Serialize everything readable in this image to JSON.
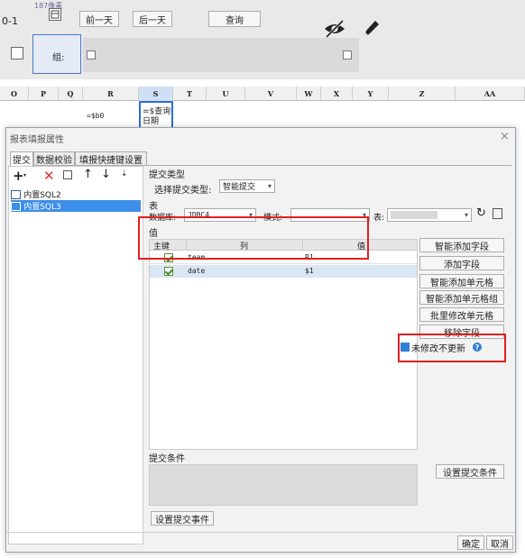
{
  "sheet": {
    "date_text": "0-1",
    "pixel_text": "187像素",
    "prev_day": "前一天",
    "next_day": "后一天",
    "query": "查询",
    "group_label": "组:",
    "columns": [
      "O",
      "P",
      "Q",
      "R",
      "S",
      "T",
      "U",
      "V",
      "W",
      "X",
      "Y",
      "Z",
      "AA"
    ],
    "cell_r": "=$b0",
    "cell_s_1": "=$查询",
    "cell_s_2": "日期"
  },
  "dialog": {
    "title": "报表填报属性",
    "close": "×",
    "tabs": [
      "提交",
      "数据校验",
      "填报快捷键设置"
    ],
    "tree_items": [
      "内置SQL2",
      "内置SQL3"
    ],
    "section_submit_type": "提交类型",
    "label_select_type": "选择提交类型:",
    "select_type_value": "智能提交",
    "section_table": "表",
    "label_db": "数据库:",
    "db_value": "JDBC4",
    "label_schema": "模式:",
    "schema_value": "",
    "label_table": "表:",
    "section_value": "值",
    "grid_headers": [
      "主键",
      "列",
      "值"
    ],
    "grid_rows": [
      {
        "key": true,
        "col": "team",
        "val": "R1"
      },
      {
        "key": true,
        "col": "date",
        "val": "$1"
      }
    ],
    "side_buttons": [
      "智能添加字段",
      "添加字段",
      "智能添加单元格",
      "智能添加单元格组",
      "批里修改单元格",
      "移除字段"
    ],
    "no_change_label": "未修改不更新",
    "section_condition": "提交条件",
    "set_condition": "设置提交条件",
    "set_event": "设置提交事件",
    "ok": "确定",
    "cancel": "取消"
  }
}
